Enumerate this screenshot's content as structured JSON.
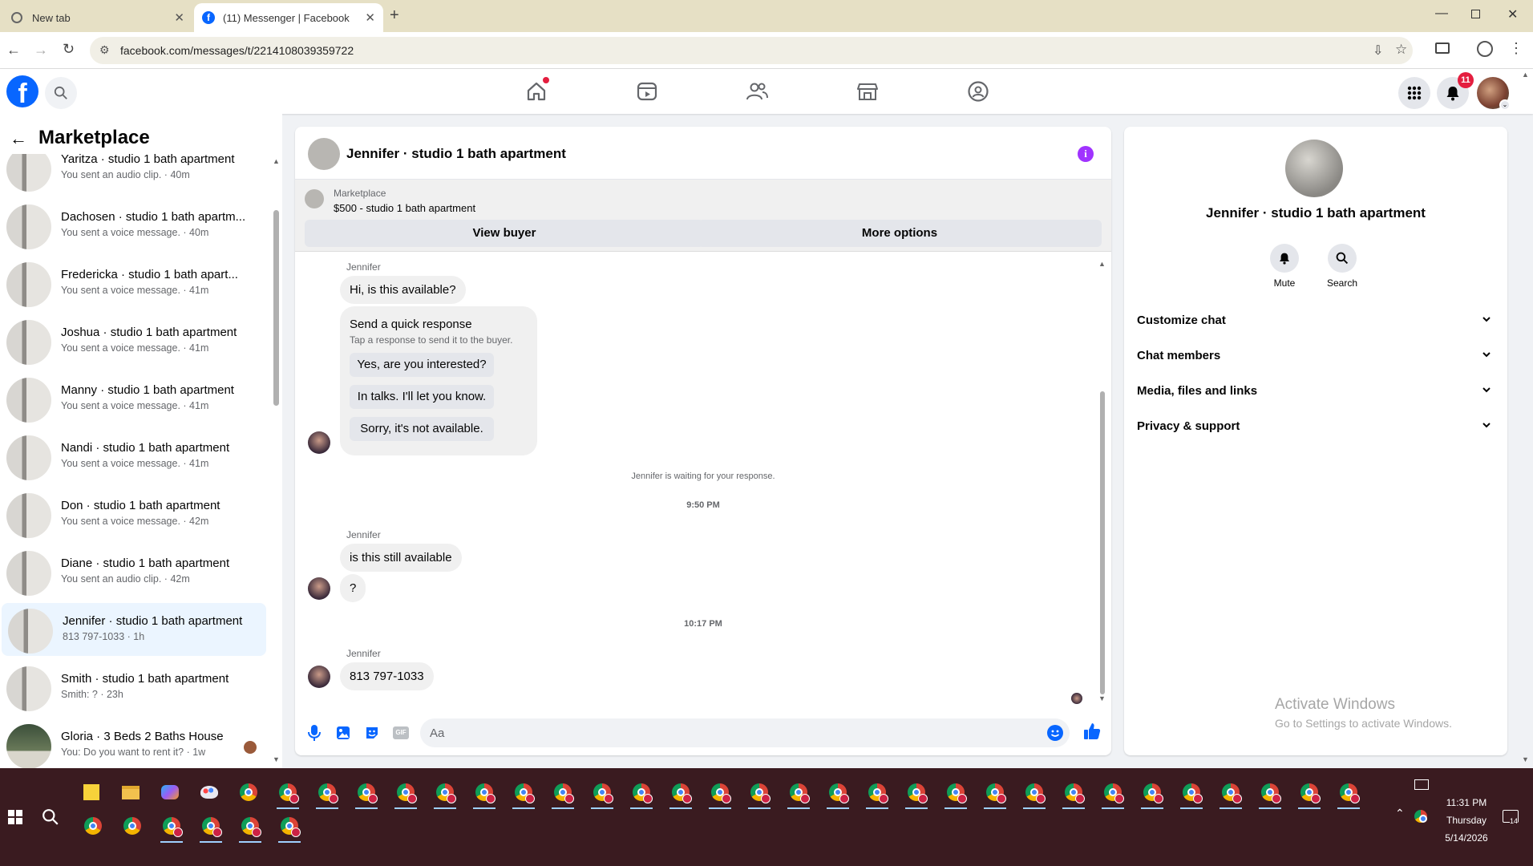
{
  "browser": {
    "tabs": [
      {
        "title": "New tab"
      },
      {
        "title": "(11) Messenger | Facebook"
      }
    ],
    "url": "facebook.com/messages/t/2214108039359722"
  },
  "header": {
    "notification_count": "11"
  },
  "left_panel": {
    "title": "Marketplace",
    "conversations": [
      {
        "name": "Yaritza · studio 1 bath apartment",
        "preview": "You sent an audio clip. · 40m"
      },
      {
        "name": "Dachosen · studio 1 bath apartm...",
        "preview": "You sent a voice message. · 40m"
      },
      {
        "name": "Fredericka · studio 1 bath apart...",
        "preview": "You sent a voice message. · 41m"
      },
      {
        "name": "Joshua · studio 1 bath apartment",
        "preview": "You sent a voice message. · 41m"
      },
      {
        "name": "Manny · studio 1 bath apartment",
        "preview": "You sent a voice message. · 41m"
      },
      {
        "name": "Nandi · studio 1 bath apartment",
        "preview": "You sent a voice message. · 41m"
      },
      {
        "name": "Don · studio 1 bath apartment",
        "preview": "You sent a voice message. · 42m"
      },
      {
        "name": "Diane · studio 1 bath apartment",
        "preview": "You sent an audio clip. · 42m"
      },
      {
        "name": "Jennifer · studio 1 bath apartment",
        "preview": "813 797-1033 · 1h"
      },
      {
        "name": "Smith · studio 1 bath apartment",
        "preview": "Smith: ? · 23h"
      },
      {
        "name": "Gloria · 3 Beds 2 Baths House",
        "preview": "You: Do you want to rent it? · 1w"
      }
    ]
  },
  "chat": {
    "title": "Jennifer · studio 1 bath apartment",
    "listing": {
      "label": "Marketplace",
      "price_title": "$500 - studio 1 bath apartment",
      "view_buyer": "View buyer",
      "more_options": "More options"
    },
    "messages": {
      "sender1": "Jennifer",
      "msg1": "Hi, is this available?",
      "quick_title": "Send a quick response",
      "quick_sub": "Tap a response to send it to the buyer.",
      "quick_responses": [
        "Yes, are you interested?",
        "In talks. I'll let you know.",
        "Sorry, it's not available."
      ],
      "waiting": "Jennifer is waiting for your response.",
      "time1": "9:50 PM",
      "sender2": "Jennifer",
      "msg2": "is this still available",
      "msg3": "?",
      "time2": "10:17 PM",
      "sender3": "Jennifer",
      "msg4": "813 797-1033"
    },
    "composer_placeholder": "Aa"
  },
  "right_panel": {
    "name": "Jennifer · studio 1 bath apartment",
    "mute": "Mute",
    "search": "Search",
    "sections": [
      "Customize chat",
      "Chat members",
      "Media, files and links",
      "Privacy & support"
    ]
  },
  "watermark": {
    "line1": "Activate Windows",
    "line2": "Go to Settings to activate Windows."
  },
  "taskbar": {
    "time": "11:31 PM",
    "day": "Thursday",
    "date": "5/14/2026",
    "notif_count": "14"
  },
  "colors": {
    "fb_blue": "#0866ff",
    "accent_purple": "#a033ff",
    "notif_red": "#e41e3f",
    "selected_bg": "#ebf5ff"
  }
}
